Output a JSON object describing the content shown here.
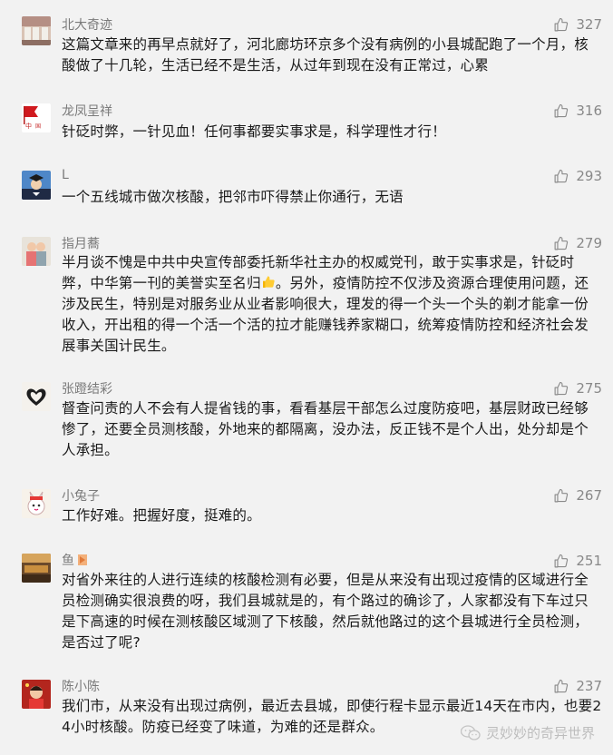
{
  "comments": [
    {
      "nickname": "北大奇迹",
      "likes": "327",
      "text": "这篇文章来的再早点就好了，河北廊坊环京多个没有病例的小县城配跑了一个月，核酸做了十几轮，生活已经不是生活，从过年到现在没有正常过，心累"
    },
    {
      "nickname": "龙凤呈祥",
      "likes": "316",
      "text": "针砭时弊，一针见血！任何事都要实事求是，科学理性才行！"
    },
    {
      "nickname": "L",
      "likes": "293",
      "text": "一个五线城市做次核酸，把邻市吓得禁止你通行，无语"
    },
    {
      "nickname": "指月蕎",
      "likes": "279",
      "text_a": "半月谈不愧是中共中央宣传部委托新华社主办的权威党刊，敢于实事求是，针砭时弊，中华第一刊的美誉实至名归",
      "text_b": "。另外，疫情防控不仅涉及资源合理使用问题，还涉及民生，特别是对服务业从业者影响很大，理发的得一个头一个头的剃才能拿一份收入，开出租的得一个活一个活的拉才能赚钱养家糊口，统筹疫情防控和经济社会发展事关国计民生。"
    },
    {
      "nickname": "张蹬结彩",
      "likes": "275",
      "text": "督查问责的人不会有人提省钱的事，看看基层干部怎么过度防疫吧，基层财政已经够惨了，还要全员测核酸，外地来的都隔离，没办法，反正钱不是个人出，处分却是个人承担。"
    },
    {
      "nickname": "小兔子",
      "likes": "267",
      "text": "工作好难。把握好度，挺难的。"
    },
    {
      "nickname": "鱼",
      "likes": "251",
      "text": "对省外来往的人进行连续的核酸检测有必要，但是从来没有出现过疫情的区域进行全员检测确实很浪费的呀，我们县城就是的，有个路过的确诊了，人家都没有下车过只是下高速的时候在测核酸区域测了下核酸，然后就他路过的这个县城进行全员检测，是否过了呢?"
    },
    {
      "nickname": "陈小陈",
      "likes": "237",
      "text": "我们市，从来没有出现过病例，最近去县城，即使行程卡显示最近14天在市内，也要24小时核酸。防疫已经变了味道，为难的还是群众。"
    }
  ],
  "watermark": "灵妙妙的奇异世界",
  "icons": {
    "like": "thumbs-up-outline-icon",
    "emoji": "thumbs-up-emoji-icon",
    "watermark": "wechat-icon"
  },
  "colors": {
    "background": "#f2f2f2",
    "nickname": "#7a7a7a",
    "text": "#1a1a1a",
    "like": "#888888",
    "watermark": "#bdbdbd"
  }
}
